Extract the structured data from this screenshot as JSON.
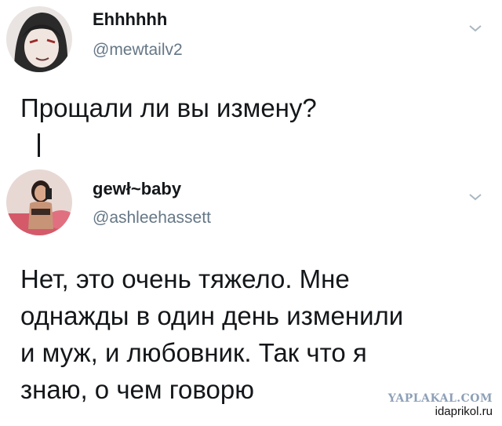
{
  "tweets": [
    {
      "display_name": "Ehhhhhh",
      "handle": "@mewtailv2",
      "text": "Прощали ли вы измену?"
    },
    {
      "display_name": "gewł~baby",
      "handle": "@ashleehassett",
      "text": "Нет, это очень тяжело. Мне\nоднажды в один день изменили\nи муж, и любовник. Так что я\nзнаю, о чем говорю"
    }
  ],
  "watermark": {
    "site": "YAPLAKAL.COM",
    "source": "idaprikol.ru"
  },
  "icons": {
    "avatar_1": "avatar",
    "avatar_2": "avatar",
    "menu": "chevron-down-icon"
  }
}
